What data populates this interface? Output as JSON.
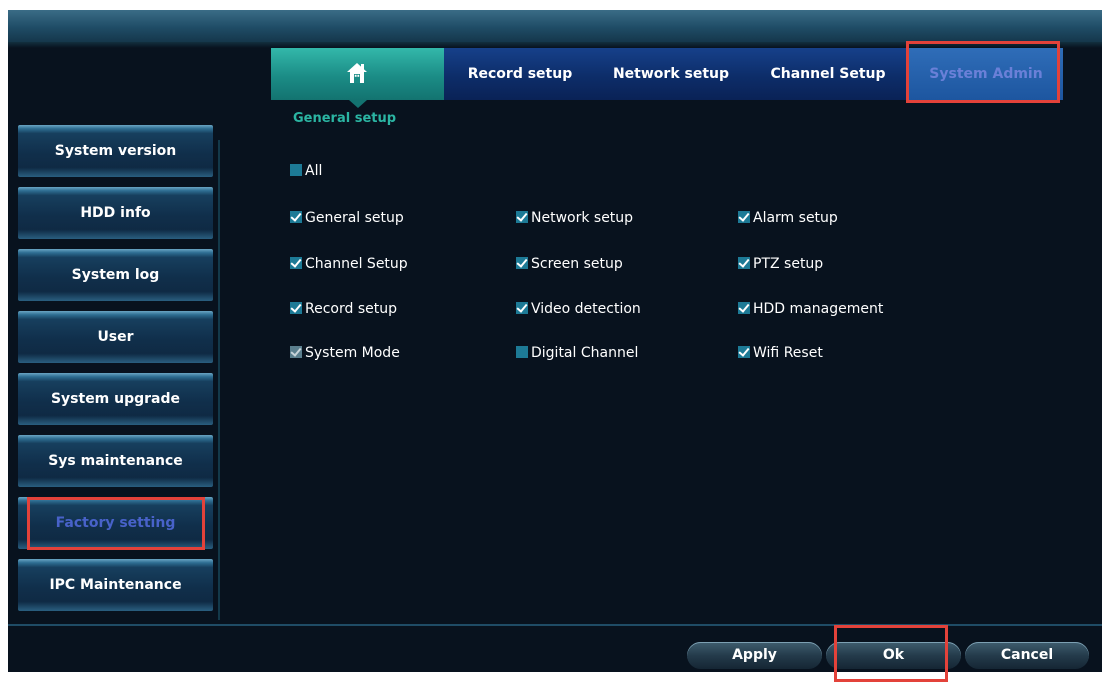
{
  "colors": {
    "window_bg": "#08121e",
    "tab_bar": "#0d2d69",
    "active_tab": "#1b8c86",
    "accent_teal": "#2bb5a3",
    "selected_text": "#4862c9",
    "highlight_outline": "#e3423a",
    "checkbox": "#1d7a96"
  },
  "tabs": {
    "home_icon": "home-icon",
    "record_setup": "Record setup",
    "network_setup": "Network setup",
    "channel_setup": "Channel Setup",
    "system_admin": "System Admin"
  },
  "sub_header": "General setup",
  "sidebar": {
    "items": [
      {
        "label": "System version"
      },
      {
        "label": "HDD info"
      },
      {
        "label": "System log"
      },
      {
        "label": "User"
      },
      {
        "label": "System upgrade"
      },
      {
        "label": "Sys maintenance"
      },
      {
        "label": "Factory setting",
        "selected": true
      },
      {
        "label": "IPC Maintenance"
      }
    ]
  },
  "options": {
    "all": {
      "label": "All",
      "checked": false
    },
    "general_setup": {
      "label": "General setup",
      "checked": true
    },
    "network_setup": {
      "label": "Network setup",
      "checked": true
    },
    "alarm_setup": {
      "label": "Alarm setup",
      "checked": true
    },
    "channel_setup": {
      "label": "Channel Setup",
      "checked": true
    },
    "screen_setup": {
      "label": "Screen setup",
      "checked": true
    },
    "ptz_setup": {
      "label": "PTZ setup",
      "checked": true
    },
    "record_setup": {
      "label": "Record setup",
      "checked": true
    },
    "video_detection": {
      "label": "Video detection",
      "checked": true
    },
    "hdd_management": {
      "label": "HDD management",
      "checked": true
    },
    "system_mode": {
      "label": "System Mode",
      "checked": true,
      "disabled": true
    },
    "digital_channel": {
      "label": "Digital Channel",
      "checked": false
    },
    "wifi_reset": {
      "label": "Wifi Reset",
      "checked": true
    }
  },
  "buttons": {
    "apply": "Apply",
    "ok": "Ok",
    "cancel": "Cancel"
  }
}
